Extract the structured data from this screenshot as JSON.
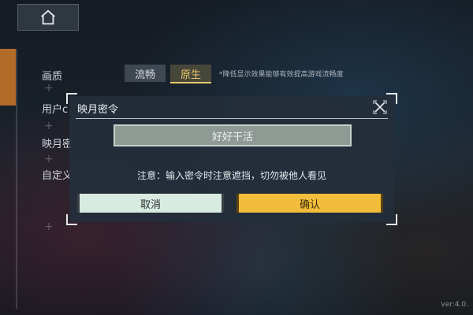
{
  "settings": {
    "quality_label": "画质",
    "quality_options": [
      "流畅",
      "原生"
    ],
    "quality_hint": "*降低显示效果能够有效提高游戏流畅度",
    "row2_label": "用户c",
    "row3_label": "映月密",
    "row4_label": "自定义"
  },
  "modal": {
    "title": "映月密令",
    "password_value": "好好干活",
    "notice": "注意：输入密令时注意遮挡，切勿被他人看见",
    "cancel_label": "取消",
    "confirm_label": "确认"
  },
  "footer": {
    "version": "ver:4.0."
  },
  "icons": {
    "home": "home-icon",
    "close": "close-icon"
  },
  "colors": {
    "accent": "#f2bd3a",
    "side_accent": "#b36b2a",
    "cancel_bg": "#d8ebe0"
  }
}
